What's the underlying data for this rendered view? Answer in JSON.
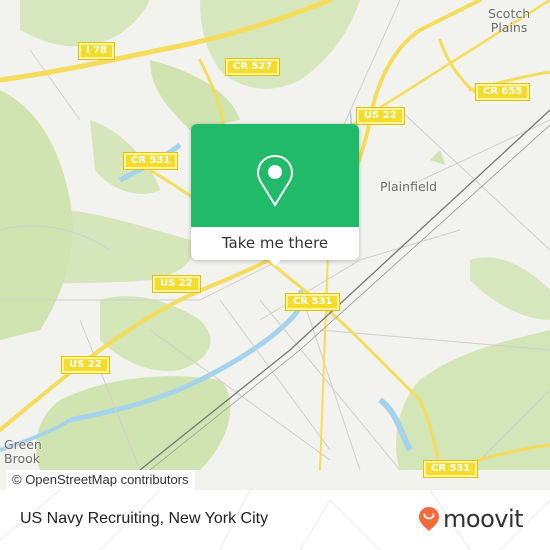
{
  "map": {
    "place_labels": [
      {
        "id": "scotch-plains",
        "text": "Scotch\nPlains"
      },
      {
        "id": "plainfield",
        "text": "Plainfield"
      },
      {
        "id": "green-brook",
        "text": "Green\nBrook"
      }
    ],
    "road_labels": [
      {
        "id": "i78",
        "text": "I 78"
      },
      {
        "id": "cr527",
        "text": "CR 527"
      },
      {
        "id": "cr655",
        "text": "CR 655"
      },
      {
        "id": "us22-ne",
        "text": "US 22"
      },
      {
        "id": "cr531-nw",
        "text": "CR 531"
      },
      {
        "id": "us22-mid",
        "text": "US 22"
      },
      {
        "id": "cr531-center",
        "text": "CR 531"
      },
      {
        "id": "us22-sw",
        "text": "US 22"
      },
      {
        "id": "cr531-se",
        "text": "CR 531"
      }
    ],
    "colors": {
      "background": "#f2f2ee",
      "park": "#cfe4b0",
      "water": "#a6d3ec",
      "highway": "#f5dc5a",
      "minor_road": "#cfcfcf",
      "rail": "#777777"
    }
  },
  "popup": {
    "cta_label": "Take me there",
    "icon": "map-pin-icon",
    "color": "#21ba6a"
  },
  "attribution": "© OpenStreetMap contributors",
  "footer": {
    "title": "US Navy Recruiting, New York City",
    "brand": "moovit",
    "brand_icon": "moovit-smile-pin-icon",
    "brand_color": "#f26b3a"
  }
}
